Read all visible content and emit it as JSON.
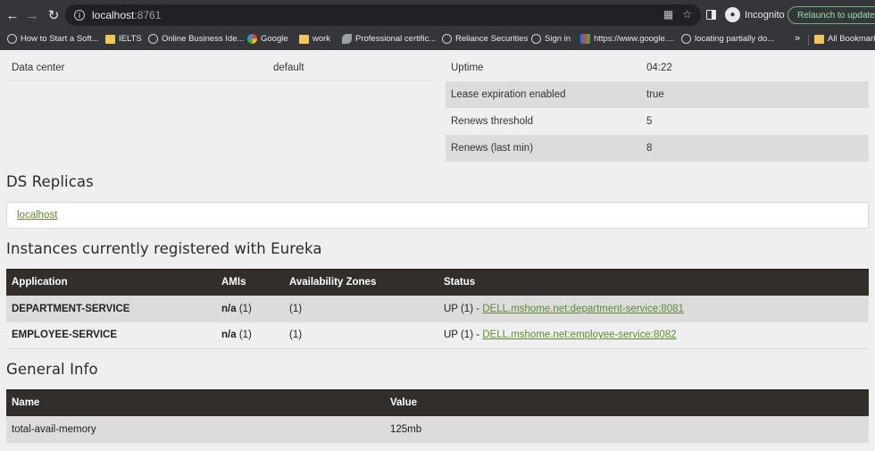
{
  "browser": {
    "url_host": "localhost",
    "url_port": ":8761",
    "profile_label": "Incognito",
    "relaunch_label": "Relaunch to update"
  },
  "bookmarks": [
    {
      "label": "How to Start a Soft...",
      "icon": "globe-icon"
    },
    {
      "label": "IELTS",
      "icon": "folder-icon"
    },
    {
      "label": "Online Business Ide...",
      "icon": "globe-icon"
    },
    {
      "label": "Google",
      "icon": "google-icon"
    },
    {
      "label": "work",
      "icon": "folder-icon"
    },
    {
      "label": "Professional certific...",
      "icon": "leaf-icon"
    },
    {
      "label": "Reliance Securities",
      "icon": "globe-icon"
    },
    {
      "label": "Sign in",
      "icon": "globe-icon"
    },
    {
      "label": "https://www.google....",
      "icon": "multicolor-icon"
    },
    {
      "label": "locating partially do...",
      "icon": "globe-icon"
    }
  ],
  "bookmarks_more": "»",
  "bookmarks_all": "All Bookmarks",
  "stats_left": [
    {
      "name": "Data center",
      "value": "default"
    }
  ],
  "stats_right": [
    {
      "name": "Uptime",
      "value": "04:22"
    },
    {
      "name": "Lease expiration enabled",
      "value": "true"
    },
    {
      "name": "Renews threshold",
      "value": "5"
    },
    {
      "name": "Renews (last min)",
      "value": "8"
    }
  ],
  "replicas": {
    "title": "DS Replicas",
    "link": "localhost"
  },
  "instances": {
    "title": "Instances currently registered with Eureka",
    "headers": [
      "Application",
      "AMIs",
      "Availability Zones",
      "Status"
    ],
    "rows": [
      {
        "application": "DEPARTMENT-SERVICE",
        "amis_bold": "n/a",
        "amis_count": "(1)",
        "zones": "(1)",
        "status_prefix": "UP (1) - ",
        "status_link": "DELL.mshome.net:department-service:8081"
      },
      {
        "application": "EMPLOYEE-SERVICE",
        "amis_bold": "n/a",
        "amis_count": "(1)",
        "zones": "(1)",
        "status_prefix": "UP (1) - ",
        "status_link": "DELL.mshome.net:employee-service:8082"
      }
    ]
  },
  "general_info": {
    "title": "General Info",
    "headers": [
      "Name",
      "Value"
    ],
    "rows": [
      {
        "name": "total-avail-memory",
        "value": "125mb"
      }
    ]
  }
}
